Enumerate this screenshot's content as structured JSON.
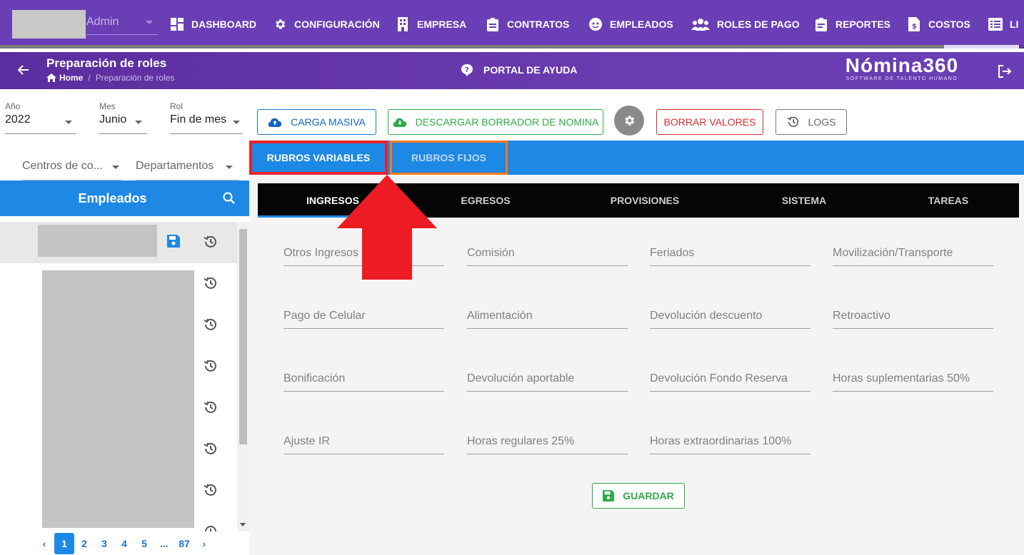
{
  "topnav": {
    "user": "Admin",
    "items": [
      {
        "label": "DASHBOARD",
        "icon": "dashboard-icon"
      },
      {
        "label": "CONFIGURACIÓN",
        "icon": "gear-icon"
      },
      {
        "label": "EMPRESA",
        "icon": "building-icon"
      },
      {
        "label": "CONTRATOS",
        "icon": "clipboard-icon"
      },
      {
        "label": "EMPLEADOS",
        "icon": "face-icon"
      },
      {
        "label": "ROLES DE PAGO",
        "icon": "users-icon"
      },
      {
        "label": "REPORTES",
        "icon": "report-icon"
      },
      {
        "label": "COSTOS",
        "icon": "cost-file-icon"
      },
      {
        "label": "LI",
        "icon": "list-icon"
      }
    ]
  },
  "header": {
    "title": "Preparación de roles",
    "breadcrumb": {
      "home": "Home",
      "current": "Preparación de roles"
    },
    "help": "PORTAL DE AYUDA",
    "brand": {
      "name": "Nómina360",
      "tagline": "SOFTWARE DE TALENTO HUMANO"
    }
  },
  "filters": {
    "year": {
      "label": "Año",
      "value": "2022"
    },
    "month": {
      "label": "Mes",
      "value": "Junio"
    },
    "role": {
      "label": "Rol",
      "value": "Fin de mes"
    },
    "cost_center": {
      "placeholder": "Centros de co..."
    },
    "department": {
      "placeholder": "Departamentos"
    }
  },
  "actions": {
    "bulk_upload": "CARGA MASIVA",
    "download_draft": "DESCARGAR BORRADOR DE NOMINA",
    "clear_values": "BORRAR VALORES",
    "logs": "LOGS"
  },
  "employees": {
    "title": "Empleados",
    "pagination": {
      "pages": [
        "1",
        "2",
        "3",
        "4",
        "5",
        "...",
        "87"
      ],
      "current": "1"
    }
  },
  "tabs": {
    "variable": "RUBROS VARIABLES",
    "fixed": "RUBROS FIJOS"
  },
  "subtabs": [
    "INGRESOS",
    "EGRESOS",
    "PROVISIONES",
    "SISTEMA",
    "TAREAS"
  ],
  "fields": [
    "Otros Ingresos",
    "Comisión",
    "Feriados",
    "Movilización/Transporte",
    "Pago de Celular",
    "Alimentación",
    "Devolución descuento",
    "Retroactivo",
    "Bonificación",
    "Devolución aportable",
    "Devolución Fondo Reserva",
    "Horas suplementarias 50%",
    "Ajuste IR",
    "Horas regulares 25%",
    "Horas extraordinarias 100%"
  ],
  "save_label": "GUARDAR",
  "colors": {
    "nav": "#6a3fb5",
    "tab_bar": "#1e88e5",
    "highlight_red": "#e8232b",
    "highlight_orange": "#ff7a1a"
  }
}
